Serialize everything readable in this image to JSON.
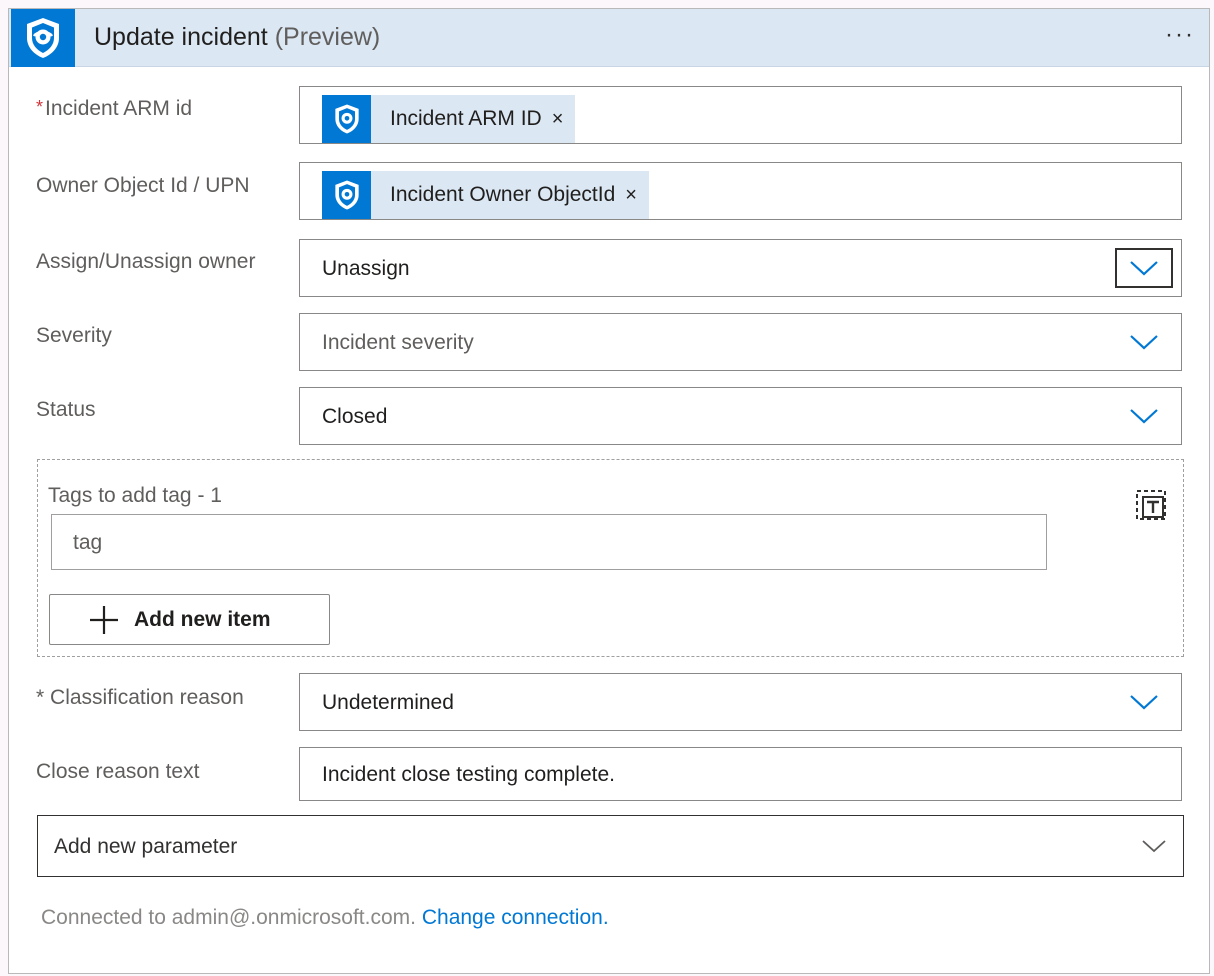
{
  "header": {
    "title": "Update incident",
    "title_suffix": "(Preview)",
    "more_label": "···",
    "icon": "shield-icon"
  },
  "fields": {
    "incident_arm_id": {
      "required_marker": "*",
      "label": "Incident ARM id",
      "token_label": "Incident ARM ID",
      "token_remove": "×"
    },
    "owner": {
      "label": "Owner Object Id / UPN",
      "token_label": "Incident Owner ObjectId",
      "token_remove": "×"
    },
    "assign": {
      "label": "Assign/Unassign owner",
      "value": "Unassign"
    },
    "severity": {
      "label": "Severity",
      "placeholder": "Incident severity"
    },
    "status": {
      "label": "Status",
      "value": "Closed"
    },
    "tags": {
      "label": "Tags to add tag - 1",
      "value": "tag",
      "add_button": "Add new item"
    },
    "classification": {
      "required_marker": "*",
      "label": "Classification reason",
      "value": "Undetermined"
    },
    "close_reason": {
      "label": "Close reason text",
      "value": "Incident close testing complete."
    }
  },
  "add_parameter": {
    "label": "Add new parameter"
  },
  "footer": {
    "connected_text": "Connected to admin@.onmicrosoft.com.",
    "change_link": "Change connection."
  },
  "colors": {
    "accent": "#0078d4",
    "header_bg": "#dbe7f3",
    "required": "#d13438"
  }
}
